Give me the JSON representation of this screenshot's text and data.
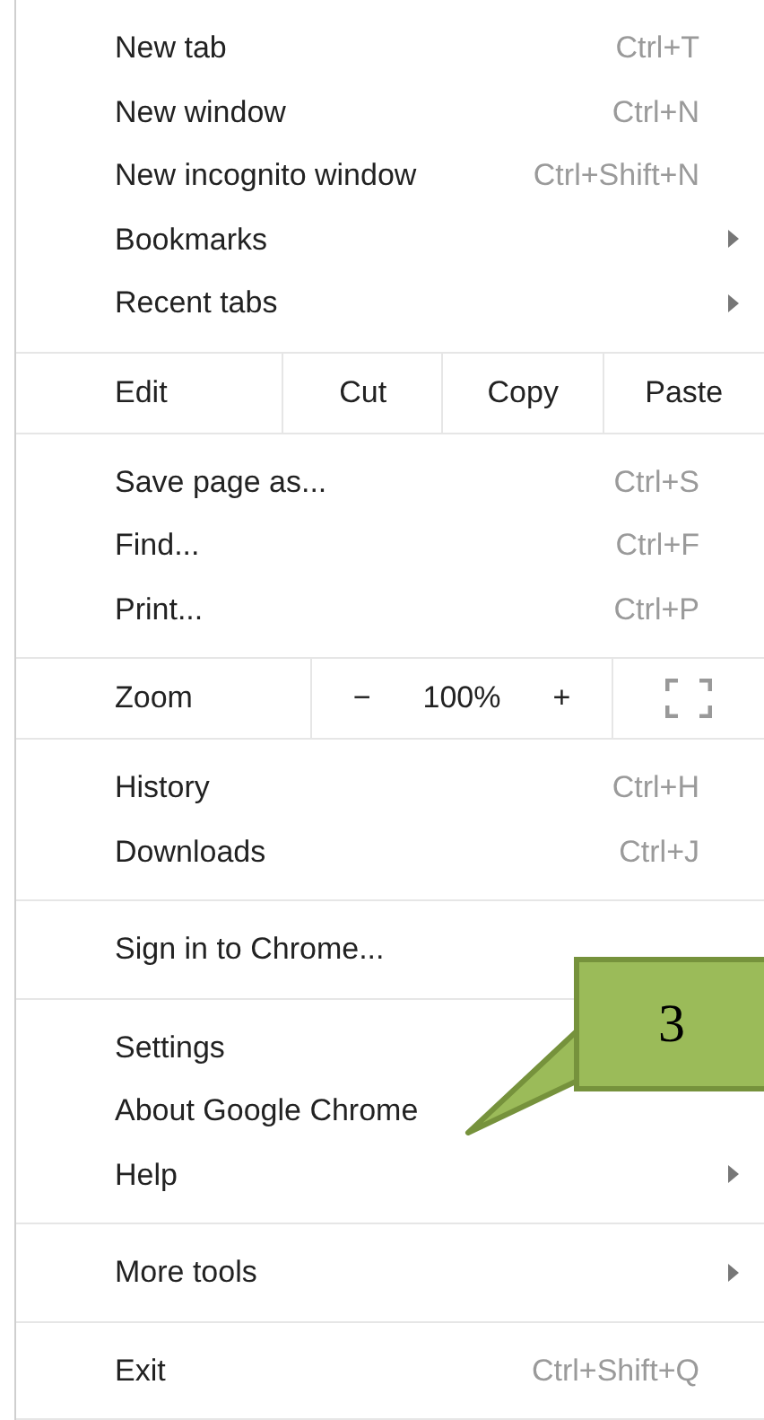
{
  "menu": {
    "sections": [
      {
        "kind": "items",
        "items": [
          {
            "label": "New tab",
            "shortcut": "Ctrl+T",
            "submenu": false
          },
          {
            "label": "New window",
            "shortcut": "Ctrl+N",
            "submenu": false
          },
          {
            "label": "New incognito window",
            "shortcut": "Ctrl+Shift+N",
            "submenu": false
          },
          {
            "label": "Bookmarks",
            "submenu": true
          },
          {
            "label": "Recent tabs",
            "submenu": true
          }
        ]
      },
      {
        "kind": "edit",
        "label": "Edit",
        "buttons": [
          "Cut",
          "Copy",
          "Paste"
        ]
      },
      {
        "kind": "items",
        "items": [
          {
            "label": "Save page as...",
            "shortcut": "Ctrl+S",
            "submenu": false
          },
          {
            "label": "Find...",
            "shortcut": "Ctrl+F",
            "submenu": false
          },
          {
            "label": "Print...",
            "shortcut": "Ctrl+P",
            "submenu": false
          }
        ]
      },
      {
        "kind": "zoom",
        "label": "Zoom",
        "minus": "−",
        "value": "100%",
        "plus": "+"
      },
      {
        "kind": "items",
        "items": [
          {
            "label": "History",
            "shortcut": "Ctrl+H",
            "submenu": false
          },
          {
            "label": "Downloads",
            "shortcut": "Ctrl+J",
            "submenu": false
          }
        ]
      },
      {
        "kind": "items",
        "items": [
          {
            "label": "Sign in to Chrome...",
            "submenu": false
          }
        ]
      },
      {
        "kind": "items",
        "items": [
          {
            "label": "Settings"
          },
          {
            "label": "About Google Chrome",
            "submenu": false
          },
          {
            "label": "Help",
            "submenu": true
          }
        ]
      },
      {
        "kind": "items",
        "items": [
          {
            "label": "More tools",
            "submenu": true
          }
        ]
      },
      {
        "kind": "items",
        "items": [
          {
            "label": "Exit",
            "shortcut": "Ctrl+Shift+Q",
            "submenu": false
          }
        ]
      }
    ]
  },
  "callout": {
    "number": "3"
  }
}
